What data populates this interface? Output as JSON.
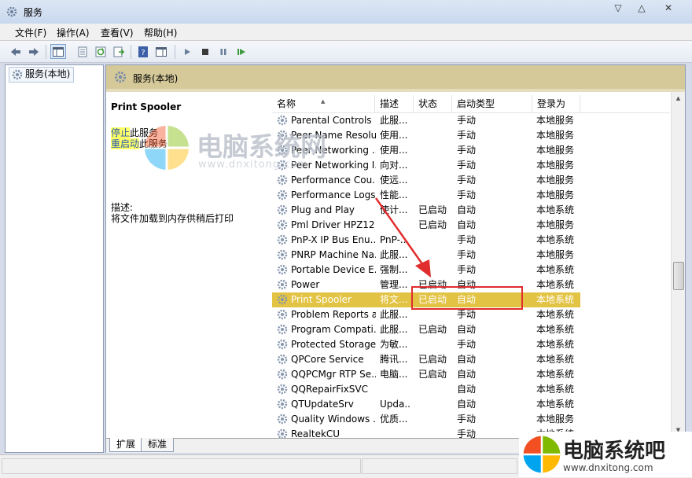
{
  "window": {
    "title": "服务"
  },
  "menu": [
    "文件(F)",
    "操作(A)",
    "查看(V)",
    "帮助(H)"
  ],
  "tree": {
    "root_label": "服务(本地)"
  },
  "panel": {
    "header_title": "服务(本地)"
  },
  "extended": {
    "service_name": "Print Spooler",
    "stop_link": "停止",
    "stop_suffix": "此服务",
    "restart_link": "重启动",
    "restart_suffix": "此服务",
    "description_label": "描述:",
    "description": "将文件加载到内存供稍后打印"
  },
  "columns": [
    "名称",
    "描述",
    "状态",
    "启动类型",
    "登录为"
  ],
  "services": [
    {
      "name": "Parental Controls",
      "desc": "此服...",
      "status": "",
      "startup": "手动",
      "logon": "本地服务"
    },
    {
      "name": "Peer Name Resolu...",
      "desc": "使用...",
      "status": "",
      "startup": "手动",
      "logon": "本地服务"
    },
    {
      "name": "Peer Networking ...",
      "desc": "使用...",
      "status": "",
      "startup": "手动",
      "logon": "本地服务"
    },
    {
      "name": "Peer Networking I...",
      "desc": "向对...",
      "status": "",
      "startup": "手动",
      "logon": "本地服务"
    },
    {
      "name": "Performance Cou...",
      "desc": "使远...",
      "status": "",
      "startup": "手动",
      "logon": "本地服务"
    },
    {
      "name": "Performance Logs...",
      "desc": "性能...",
      "status": "",
      "startup": "手动",
      "logon": "本地服务"
    },
    {
      "name": "Plug and Play",
      "desc": "使计...",
      "status": "已启动",
      "startup": "自动",
      "logon": "本地系统"
    },
    {
      "name": "Pml Driver HPZ12",
      "desc": "",
      "status": "已启动",
      "startup": "自动",
      "logon": "本地服务"
    },
    {
      "name": "PnP-X IP Bus Enu...",
      "desc": "PnP-...",
      "status": "",
      "startup": "手动",
      "logon": "本地系统"
    },
    {
      "name": "PNRP Machine Na...",
      "desc": "此服...",
      "status": "",
      "startup": "手动",
      "logon": "本地服务"
    },
    {
      "name": "Portable Device E...",
      "desc": "强制...",
      "status": "",
      "startup": "手动",
      "logon": "本地系统"
    },
    {
      "name": "Power",
      "desc": "管理...",
      "status": "已启动",
      "startup": "自动",
      "logon": "本地系统"
    },
    {
      "name": "Print Spooler",
      "desc": "将文...",
      "status": "已启动",
      "startup": "自动",
      "logon": "本地系统",
      "selected": true
    },
    {
      "name": "Problem Reports a...",
      "desc": "此服...",
      "status": "",
      "startup": "手动",
      "logon": "本地系统"
    },
    {
      "name": "Program Compati...",
      "desc": "此服...",
      "status": "已启动",
      "startup": "自动",
      "logon": "本地系统"
    },
    {
      "name": "Protected Storage",
      "desc": "为敏...",
      "status": "",
      "startup": "手动",
      "logon": "本地系统"
    },
    {
      "name": "QPCore Service",
      "desc": "腾讯...",
      "status": "已启动",
      "startup": "自动",
      "logon": "本地系统"
    },
    {
      "name": "QQPCMgr RTP Se...",
      "desc": "电脑...",
      "status": "已启动",
      "startup": "自动",
      "logon": "本地系统"
    },
    {
      "name": "QQRepairFixSVC",
      "desc": "",
      "status": "",
      "startup": "自动",
      "logon": "本地系统"
    },
    {
      "name": "QTUpdateSrv",
      "desc": "Upda...",
      "status": "",
      "startup": "自动",
      "logon": "本地系统"
    },
    {
      "name": "Quality Windows ...",
      "desc": "优质...",
      "status": "",
      "startup": "手动",
      "logon": "本地服务"
    },
    {
      "name": "RealtekCU",
      "desc": "",
      "status": "",
      "startup": "手动",
      "logon": "本地系统"
    }
  ],
  "tabs": [
    "扩展",
    "标准"
  ],
  "watermark": {
    "center_text": "电脑系统网",
    "center_url": "www.dnxitong.com",
    "corner_text": "电脑系统吧",
    "corner_url": "www.dnxitong.com"
  },
  "colors": {
    "selected_row": "#e2c344",
    "header_band": "#d5c99a",
    "link": "#2858b0",
    "highlight_box": "#e02d2d"
  },
  "icons": [
    "services-app-icon",
    "back-icon",
    "forward-icon",
    "console-tree-icon",
    "properties-icon",
    "refresh-icon",
    "export-list-icon",
    "help-icon",
    "show-hide-action-icon",
    "start-icon",
    "stop-icon",
    "pause-icon",
    "restart-icon",
    "gear-icon"
  ]
}
